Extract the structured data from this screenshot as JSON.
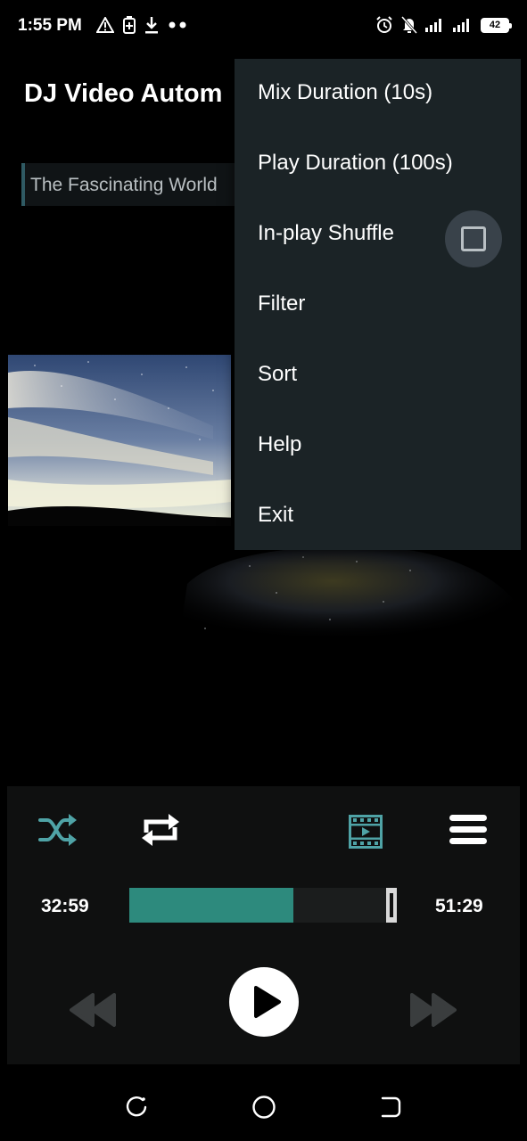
{
  "status_bar": {
    "time": "1:55 PM",
    "left_icons": [
      "warning-icon",
      "battery-saver-icon",
      "download-icon",
      "more-dots-icon"
    ],
    "right_icons": [
      "alarm-icon",
      "notifications-off-icon",
      "signal-icon",
      "signal-icon"
    ],
    "battery_level": "42"
  },
  "app": {
    "title": "DJ Video Autom",
    "now_playing_title": "The Fascinating World"
  },
  "menu": {
    "items": [
      {
        "label": "Mix Duration (10s)"
      },
      {
        "label": "Play Duration (100s)"
      },
      {
        "label": "In-play Shuffle",
        "checkbox": true,
        "checked": false
      },
      {
        "label": "Filter"
      },
      {
        "label": "Sort"
      },
      {
        "label": "Help"
      },
      {
        "label": "Exit"
      }
    ]
  },
  "player": {
    "current_time": "32:59",
    "total_time": "51:29",
    "progress_fraction": 0.64,
    "icons": [
      "shuffle-icon",
      "repeat-icon",
      "video-playlist-icon",
      "menu-icon",
      "rewind-icon",
      "play-icon",
      "fast-forward-icon"
    ],
    "colors": {
      "accent": "#2d8a7d",
      "panel": "#0f1010"
    }
  },
  "nav_bar": {
    "icons": [
      "recent-apps-icon",
      "home-icon",
      "back-icon"
    ]
  }
}
